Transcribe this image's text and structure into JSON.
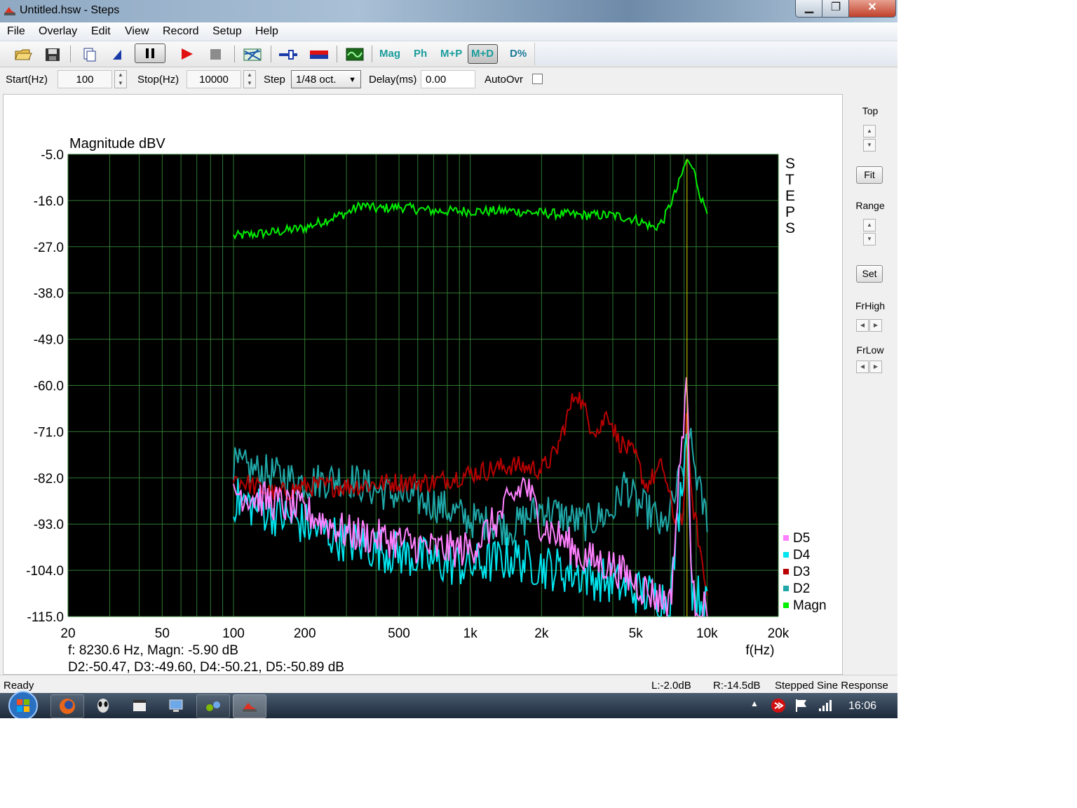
{
  "window": {
    "title": "Untitled.hsw - Steps",
    "min_icon": "minimize-icon",
    "max_icon": "maximize-icon",
    "close_label": "✕"
  },
  "menu": [
    "File",
    "Overlay",
    "Edit",
    "View",
    "Record",
    "Setup",
    "Help"
  ],
  "toolbar": {
    "mag": "Mag",
    "ph": "Ph",
    "mp": "M+P",
    "md": "M+D",
    "dpct": "D%"
  },
  "params": {
    "start_label": "Start(Hz)",
    "start_value": "100",
    "stop_label": "Stop(Hz)",
    "stop_value": "10000",
    "step_label": "Step",
    "step_value": "1/48 oct.",
    "delay_label": "Delay(ms)",
    "delay_value": "0.00",
    "autoovr_label": "AutoOvr"
  },
  "right_panel": {
    "top": "Top",
    "fit": "Fit",
    "range": "Range",
    "set": "Set",
    "frhigh": "FrHigh",
    "frlow": "FrLow"
  },
  "chart_data": {
    "type": "line",
    "title": "Magnitude dBV",
    "xlabel": "f(Hz)",
    "x_scale": "log",
    "xlim": [
      20,
      20000
    ],
    "ylim": [
      -115,
      -5
    ],
    "yticks": [
      "-5.0",
      "-16.0",
      "-27.0",
      "-38.0",
      "-49.0",
      "-60.0",
      "-71.0",
      "-82.0",
      "-93.0",
      "-104.0",
      "-115.0"
    ],
    "xticks": [
      {
        "f": 20,
        "label": "20"
      },
      {
        "f": 50,
        "label": "50"
      },
      {
        "f": 100,
        "label": "100"
      },
      {
        "f": 200,
        "label": "200"
      },
      {
        "f": 500,
        "label": "500"
      },
      {
        "f": 1000,
        "label": "1k"
      },
      {
        "f": 2000,
        "label": "2k"
      },
      {
        "f": 5000,
        "label": "5k"
      },
      {
        "f": 10000,
        "label": "10k"
      },
      {
        "f": 20000,
        "label": "20k"
      }
    ],
    "side_label": "STEPS",
    "grid": true,
    "background": "#000000",
    "gridcolor": "#2f7a2f",
    "cursor_freq": 8230.6,
    "readout1": "f: 8230.6 Hz, Magn: -5.90 dB",
    "readout2": "D2:-50.47, D3:-49.60, D4:-50.21, D5:-50.89 dB",
    "legend": [
      {
        "name": "D5",
        "color": "#ff80ff"
      },
      {
        "name": "D4",
        "color": "#00e5ee"
      },
      {
        "name": "D3",
        "color": "#b80000"
      },
      {
        "name": "D2",
        "color": "#20a8a8"
      },
      {
        "name": "Magn",
        "color": "#00ee00"
      }
    ],
    "series": [
      {
        "key": "Magn",
        "color": "#00ee00",
        "noise": 1.2,
        "points": [
          [
            100,
            -24.5
          ],
          [
            150,
            -23.5
          ],
          [
            200,
            -22.5
          ],
          [
            250,
            -20.5
          ],
          [
            300,
            -19
          ],
          [
            350,
            -17
          ],
          [
            400,
            -18
          ],
          [
            500,
            -17.5
          ],
          [
            700,
            -18.5
          ],
          [
            1000,
            -18.5
          ],
          [
            1500,
            -18.5
          ],
          [
            2000,
            -19
          ],
          [
            3000,
            -19.5
          ],
          [
            4000,
            -19.5
          ],
          [
            5000,
            -20.5
          ],
          [
            6000,
            -22.5
          ],
          [
            6500,
            -21
          ],
          [
            7500,
            -13
          ],
          [
            8230,
            -6
          ],
          [
            8800,
            -9
          ],
          [
            9500,
            -16
          ],
          [
            10000,
            -18
          ]
        ]
      },
      {
        "key": "D2",
        "color": "#20a8a8",
        "noise": 4.5,
        "points": [
          [
            100,
            -79
          ],
          [
            200,
            -83
          ],
          [
            300,
            -82
          ],
          [
            400,
            -85
          ],
          [
            700,
            -88
          ],
          [
            1000,
            -92
          ],
          [
            1500,
            -94
          ],
          [
            2000,
            -89
          ],
          [
            3000,
            -93
          ],
          [
            4000,
            -90
          ],
          [
            4500,
            -83
          ],
          [
            5000,
            -88
          ],
          [
            6000,
            -91
          ],
          [
            6500,
            -95
          ],
          [
            7200,
            -88
          ],
          [
            8000,
            -78
          ],
          [
            8230,
            -70
          ],
          [
            8800,
            -78
          ],
          [
            9500,
            -88
          ],
          [
            10000,
            -91
          ]
        ]
      },
      {
        "key": "D3",
        "color": "#b80000",
        "noise": 2.5,
        "points": [
          [
            100,
            -82
          ],
          [
            150,
            -86
          ],
          [
            200,
            -84
          ],
          [
            300,
            -84
          ],
          [
            500,
            -83
          ],
          [
            700,
            -83
          ],
          [
            1000,
            -81
          ],
          [
            1500,
            -79
          ],
          [
            2000,
            -80
          ],
          [
            2300,
            -76
          ],
          [
            2800,
            -61
          ],
          [
            3200,
            -69
          ],
          [
            3500,
            -71
          ],
          [
            3800,
            -66
          ],
          [
            4200,
            -73
          ],
          [
            5000,
            -77
          ],
          [
            5500,
            -84
          ],
          [
            6500,
            -79
          ],
          [
            7200,
            -91
          ],
          [
            8000,
            -92
          ],
          [
            8230,
            -60
          ],
          [
            8500,
            -85
          ],
          [
            9000,
            -93
          ],
          [
            10000,
            -110
          ]
        ]
      },
      {
        "key": "D4",
        "color": "#00e5ee",
        "noise": 5.5,
        "points": [
          [
            100,
            -87
          ],
          [
            200,
            -93
          ],
          [
            300,
            -97
          ],
          [
            500,
            -100
          ],
          [
            700,
            -102
          ],
          [
            1000,
            -103
          ],
          [
            1500,
            -101
          ],
          [
            2000,
            -103
          ],
          [
            3000,
            -105
          ],
          [
            4000,
            -107
          ],
          [
            5000,
            -109
          ],
          [
            6000,
            -110
          ],
          [
            7000,
            -111
          ],
          [
            8230,
            -70
          ],
          [
            8600,
            -108
          ],
          [
            10000,
            -113
          ]
        ]
      },
      {
        "key": "D5",
        "color": "#ff80ff",
        "noise": 4.5,
        "points": [
          [
            100,
            -85
          ],
          [
            200,
            -90
          ],
          [
            300,
            -95
          ],
          [
            500,
            -97
          ],
          [
            700,
            -99
          ],
          [
            1000,
            -99
          ],
          [
            1300,
            -92
          ],
          [
            1700,
            -83
          ],
          [
            2000,
            -93
          ],
          [
            2500,
            -97
          ],
          [
            3000,
            -101
          ],
          [
            4000,
            -103
          ],
          [
            5000,
            -107
          ],
          [
            6000,
            -110
          ],
          [
            7000,
            -112
          ],
          [
            8230,
            -56
          ],
          [
            8600,
            -110
          ],
          [
            10000,
            -114
          ]
        ]
      }
    ]
  },
  "status": {
    "ready": "Ready",
    "l": "L:-2.0dB",
    "r": "R:-14.5dB",
    "mode": "Stepped Sine Response"
  },
  "taskbar": {
    "clock": "16:06"
  }
}
